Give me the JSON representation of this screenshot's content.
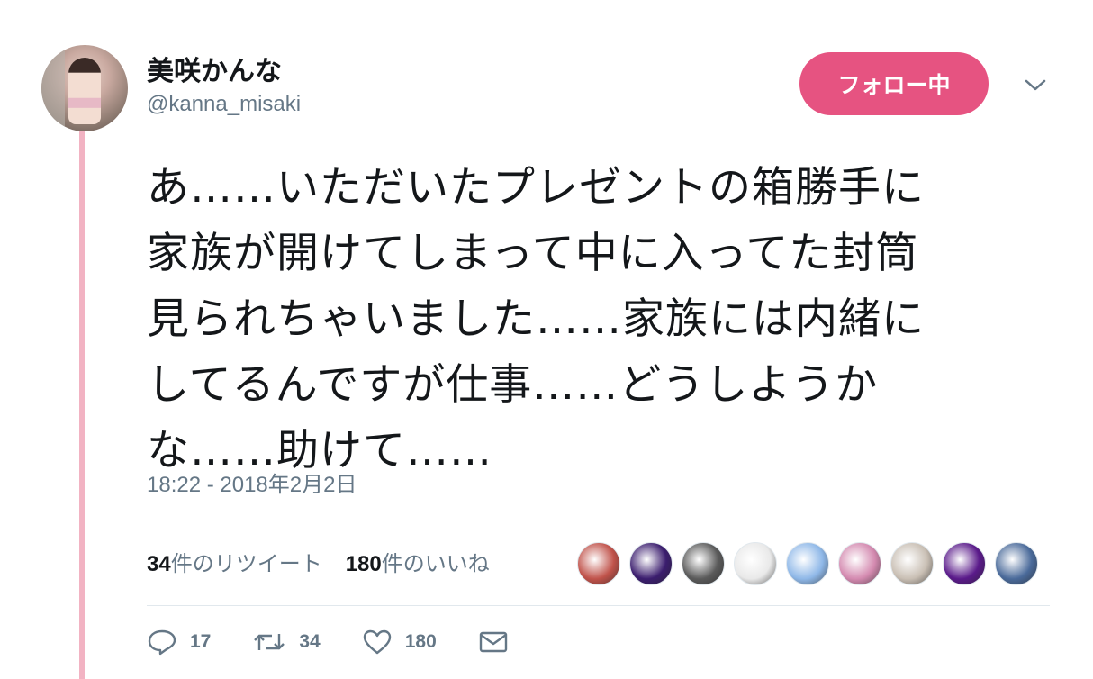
{
  "user": {
    "display_name": "美咲かんな",
    "handle": "@kanna_misaki"
  },
  "follow_button_label": "フォロー中",
  "tweet": {
    "lines": [
      "あ……いただいたプレゼントの箱勝手に",
      "家族が開けてしまって中に入ってた封筒",
      "見られちゃいました……家族には内緒に",
      "してるんですが仕事……どうしようか",
      "な……助けて……"
    ],
    "timestamp": "18:22 - 2018年2月2日"
  },
  "stats": {
    "retweets_count": "34",
    "retweets_label": "件のリツイート",
    "likes_count": "180",
    "likes_label": "件のいいね"
  },
  "liker_avatars": [
    {
      "name": "liker-1",
      "color": "#c0524a"
    },
    {
      "name": "liker-2",
      "color": "#3b1d6e"
    },
    {
      "name": "liker-3",
      "color": "#5a5a5a"
    },
    {
      "name": "liker-4",
      "color": "#e9e9e9"
    },
    {
      "name": "liker-5",
      "color": "#8fb8e8"
    },
    {
      "name": "liker-6",
      "color": "#d48ab0"
    },
    {
      "name": "liker-7",
      "color": "#c9bfb4"
    },
    {
      "name": "liker-8",
      "color": "#5a1a8a"
    },
    {
      "name": "liker-9",
      "color": "#4a6a9a"
    }
  ],
  "actions": {
    "reply_count": "17",
    "retweet_count": "34",
    "like_count": "180"
  },
  "colors": {
    "accent": "#e0245e",
    "thread_line": "#f2b3c3",
    "secondary_text": "#657786"
  }
}
